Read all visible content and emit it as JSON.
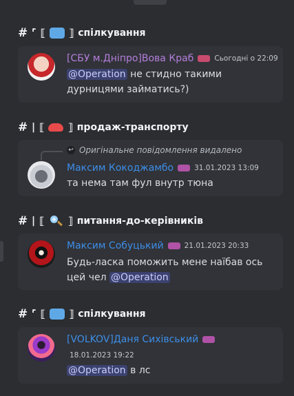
{
  "sections": [
    {
      "channel": {
        "hash": "#",
        "deco": "⌜",
        "bracket_open": "⟦",
        "emoji": "speech-bubble-emoji",
        "bracket_close": "⟧",
        "name": "спілкування"
      },
      "message": {
        "author": "[СБУ м.Дніпро]Вова Краб",
        "author_color": "#b57edc",
        "timestamp": "Сьогодні о 22:09",
        "mention": "@Operation",
        "text_after_mention": " не стидно такими дурницями займатись?)"
      }
    },
    {
      "channel": {
        "hash": "#",
        "deco": "|",
        "bracket_open": "⟦",
        "emoji": "car-emoji",
        "bracket_close": "⟧",
        "name": "продаж-транспорту"
      },
      "reply": {
        "text": "Оригінальне повідомлення видалено"
      },
      "message": {
        "author": "Максим Кокоджамбо",
        "author_color": "#3d8ee8",
        "timestamp": "31.01.2023 13:09",
        "text": "та нема там фул внутр тюна"
      }
    },
    {
      "channel": {
        "hash": "#",
        "deco": "|",
        "bracket_open": "⟦",
        "emoji": "magnifier-emoji",
        "bracket_close": "⟧",
        "name": "питання-до-керівників"
      },
      "message": {
        "author": "Максим Собуцький",
        "author_color": "#3d8ee8",
        "timestamp": "21.01.2023 20:33",
        "text_before_mention": "Будь-ласка поможить мене наїбав ось цей чел",
        "mention": "@Operation"
      }
    },
    {
      "channel": {
        "hash": "#",
        "deco": "⌜",
        "bracket_open": "⟦",
        "emoji": "speech-bubble-emoji",
        "bracket_close": "⟧",
        "name": "спілкування"
      },
      "message": {
        "author": "[VOLKOV]Даня Сихівський",
        "author_color": "#3d8ee8",
        "timestamp": "18.01.2023 19:22",
        "mention": "@Operation",
        "text_after_mention": " в лс"
      }
    }
  ]
}
